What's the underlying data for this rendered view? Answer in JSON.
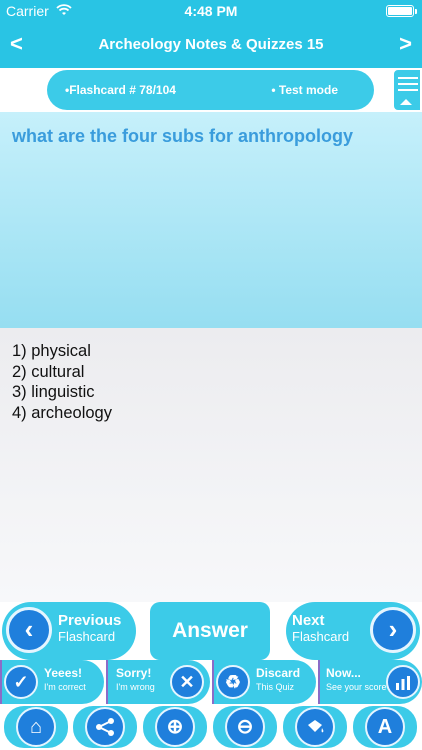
{
  "status_bar": {
    "carrier": "Carrier",
    "time": "4:48 PM"
  },
  "nav_bar": {
    "title": "Archeology Notes & Quizzes 15",
    "prev_glyph": "<",
    "next_glyph": ">"
  },
  "info_bar": {
    "flashcard_counter": "•Flashcard #  78/104",
    "mode": "• Test mode"
  },
  "question": {
    "text": "what are the four subs for anthropology"
  },
  "answer": {
    "lines": [
      "1) physical",
      "2) cultural",
      "3) linguistic",
      "4) archeology"
    ]
  },
  "actions": {
    "previous": {
      "big": "Previous",
      "small": "Flashcard"
    },
    "answer": "Answer",
    "next": {
      "big": "Next",
      "small": "Flashcard"
    }
  },
  "feedback": [
    {
      "big": "Yeees!",
      "small": "I'm correct",
      "icon": "check-icon"
    },
    {
      "big": "Sorry!",
      "small": "I'm wrong",
      "icon": "cross-icon"
    },
    {
      "big": "Discard",
      "small": "This Quiz",
      "icon": "recycle-icon"
    },
    {
      "big": "Now...",
      "small": "See your score",
      "icon": "chart-icon"
    }
  ],
  "tools": [
    "home-icon",
    "share-icon",
    "zoom-in-icon",
    "zoom-out-icon",
    "bucket-icon",
    "font-icon"
  ],
  "colors": {
    "accent": "#29c4e4",
    "button": "#3ccbe8",
    "icon_circle": "#1f7fdc",
    "question_text": "#3a9cdc"
  }
}
